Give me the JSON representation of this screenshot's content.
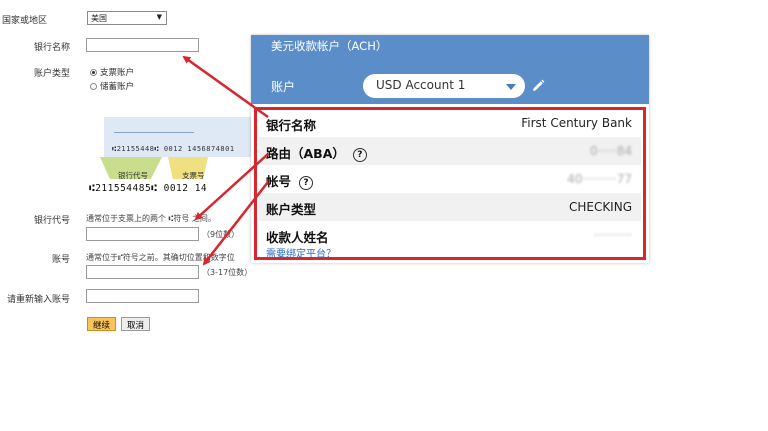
{
  "form": {
    "country_label": "国家或地区",
    "country_value": "美国",
    "bank_name_label": "银行名称",
    "account_type_label": "账户类型",
    "radio_checking": "支票账户",
    "radio_savings": "储蓄账户",
    "routing_label": "银行代号",
    "routing_hint": "通常位于支票上的两个 ⑆符号 之间。",
    "routing_digits": "（9位数）",
    "account_label": "账号",
    "account_hint": "通常位于⑈符号之前。其确切位置和数字位",
    "account_digits": "（3-17位数）",
    "reenter_label": "请重新输入账号",
    "continue_btn": "继续",
    "cancel_btn": "取消"
  },
  "check": {
    "micr_top": "⑆21155448⑆ 0012 1456874801",
    "label_routing": "银行代号",
    "label_check": "支票号",
    "micr_bottom": "⑆211554485⑆ 0012 14"
  },
  "card": {
    "title": "美元收款帐户（ACH）",
    "account_label": "账户",
    "account_value": "USD Account 1",
    "rows": [
      {
        "key": "银行名称",
        "value": "First Century Bank"
      },
      {
        "key": "路由（ABA）",
        "value": "0·····84"
      },
      {
        "key": "帐号",
        "value": "40·········77"
      },
      {
        "key": "账户类型",
        "value": "CHECKING"
      },
      {
        "key": "收款人姓名",
        "value": "··········"
      }
    ],
    "link": "需要绑定平台？"
  },
  "colors": {
    "card_header": "#5b8ec9",
    "highlight_red": "#d8262f",
    "continue_btn": "#f7c35a",
    "link": "#2a6cc0"
  },
  "icons": {
    "pencil": "pencil-icon",
    "help": "question-circle-icon",
    "dropdown": "caret-down-icon"
  }
}
